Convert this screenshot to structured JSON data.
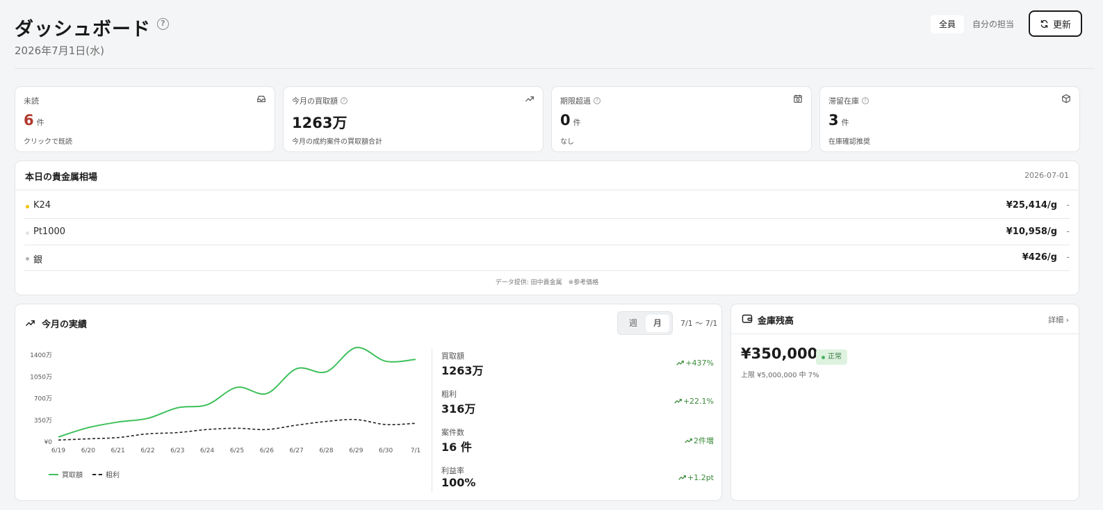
{
  "header": {
    "title": "ダッシュボード",
    "date": "2026年7月1日(水)",
    "filter_all": "全員",
    "filter_mine": "自分の担当",
    "refresh_label": "更新"
  },
  "kpis": [
    {
      "label": "未読",
      "value": "6",
      "unit": "件",
      "sub": "クリックで既読",
      "icon": "inbox-icon"
    },
    {
      "label": "今月の買取額",
      "value": "1263万",
      "unit": "",
      "sub": "今月の成約案件の買取額合計",
      "icon": "trending-up-icon"
    },
    {
      "label": "期限超過",
      "value": "0",
      "unit": "件",
      "sub": "なし",
      "icon": "calendar-clock-icon"
    },
    {
      "label": "滞留在庫",
      "value": "3",
      "unit": "件",
      "sub": "在庫確認推奨",
      "icon": "box-icon"
    }
  ],
  "metals": {
    "title": "本日の貴金属相場",
    "date": "2026-07-01",
    "rows": [
      {
        "name": "K24",
        "price": "¥25,414/g",
        "change": "-",
        "dot_color": "#f2c200"
      },
      {
        "name": "Pt1000",
        "price": "¥10,958/g",
        "change": "-",
        "dot_color": "#e2e2e2"
      },
      {
        "name": "銀",
        "price": "¥426/g",
        "change": "-",
        "dot_color": "#b5b5b5"
      }
    ],
    "footer": "データ提供: 田中貴金属　※参考価格"
  },
  "performance": {
    "title": "今月の実績",
    "tab_week": "週",
    "tab_month": "月",
    "range": "7/1 〜 7/1",
    "stats": [
      {
        "label": "買取額",
        "value": "1263万",
        "delta": "+437%"
      },
      {
        "label": "粗利",
        "value": "316万",
        "delta": "+22.1%"
      },
      {
        "label": "案件数",
        "value": "16 件",
        "delta": "2件増"
      },
      {
        "label": "利益率",
        "value": "100%",
        "delta": "+1.2pt"
      }
    ]
  },
  "chart_data": {
    "type": "line",
    "x": [
      "6/19",
      "6/20",
      "6/21",
      "6/22",
      "6/23",
      "6/24",
      "6/25",
      "6/26",
      "6/27",
      "6/28",
      "6/29",
      "6/30",
      "7/1"
    ],
    "y_ticks": [
      "¥0",
      "350万",
      "700万",
      "1050万",
      "1400万"
    ],
    "ylim": [
      0,
      1400
    ],
    "series": [
      {
        "name": "買取額",
        "color": "#3cc05a",
        "style": "solid",
        "values": [
          80,
          230,
          320,
          380,
          550,
          600,
          880,
          780,
          1180,
          1130,
          1520,
          1300,
          1330
        ]
      },
      {
        "name": "粗利",
        "color": "#222222",
        "style": "dashed",
        "values": [
          30,
          50,
          70,
          130,
          150,
          200,
          220,
          200,
          270,
          330,
          360,
          280,
          300
        ]
      }
    ]
  },
  "safe": {
    "title": "金庫残高",
    "detail": "詳細",
    "amount": "¥350,000",
    "status": "正常",
    "sub": "上限 ¥5,000,000 中 7%"
  }
}
